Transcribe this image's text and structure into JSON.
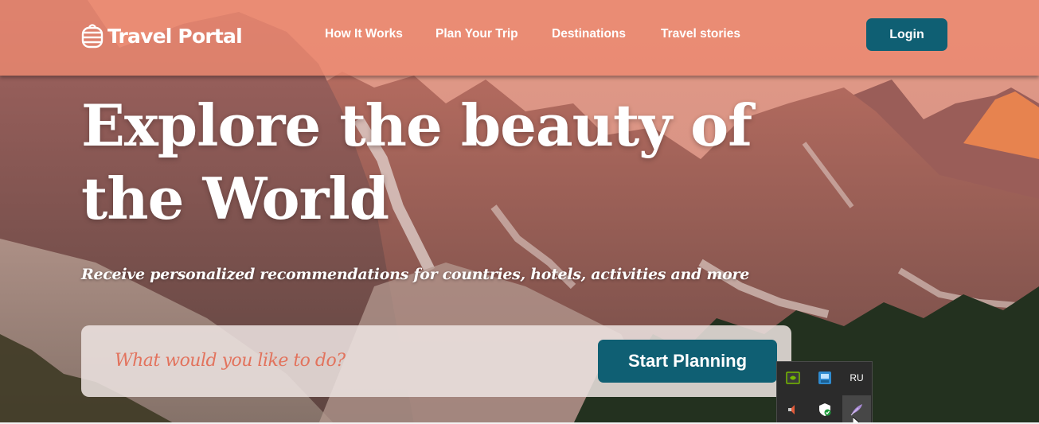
{
  "brand": {
    "name": "Travel Portal",
    "icon": "suitcase-logo-icon"
  },
  "nav": {
    "items": [
      {
        "label": "How It Works"
      },
      {
        "label": "Plan Your Trip"
      },
      {
        "label": "Destinations"
      },
      {
        "label": "Travel stories"
      }
    ],
    "login_label": "Login"
  },
  "hero": {
    "title": "Explore the beauty of the World",
    "subtitle": "Receive personalized recommendations for countries, hotels, activities and more"
  },
  "search": {
    "placeholder": "What would you like to do?",
    "value": "",
    "button_label": "Start Planning"
  },
  "tray": {
    "items": [
      {
        "icon": "nvidia-icon"
      },
      {
        "icon": "network-adapter-icon"
      },
      {
        "label": "RU",
        "icon": "language-indicator"
      },
      {
        "icon": "speaker-muted-icon"
      },
      {
        "icon": "security-shield-icon"
      },
      {
        "icon": "feather-pen-icon"
      }
    ]
  },
  "colors": {
    "accent": "#0f5f73",
    "header_bg": "#ec8970",
    "placeholder": "#e2735d",
    "search_bg": "#eee4e2"
  }
}
